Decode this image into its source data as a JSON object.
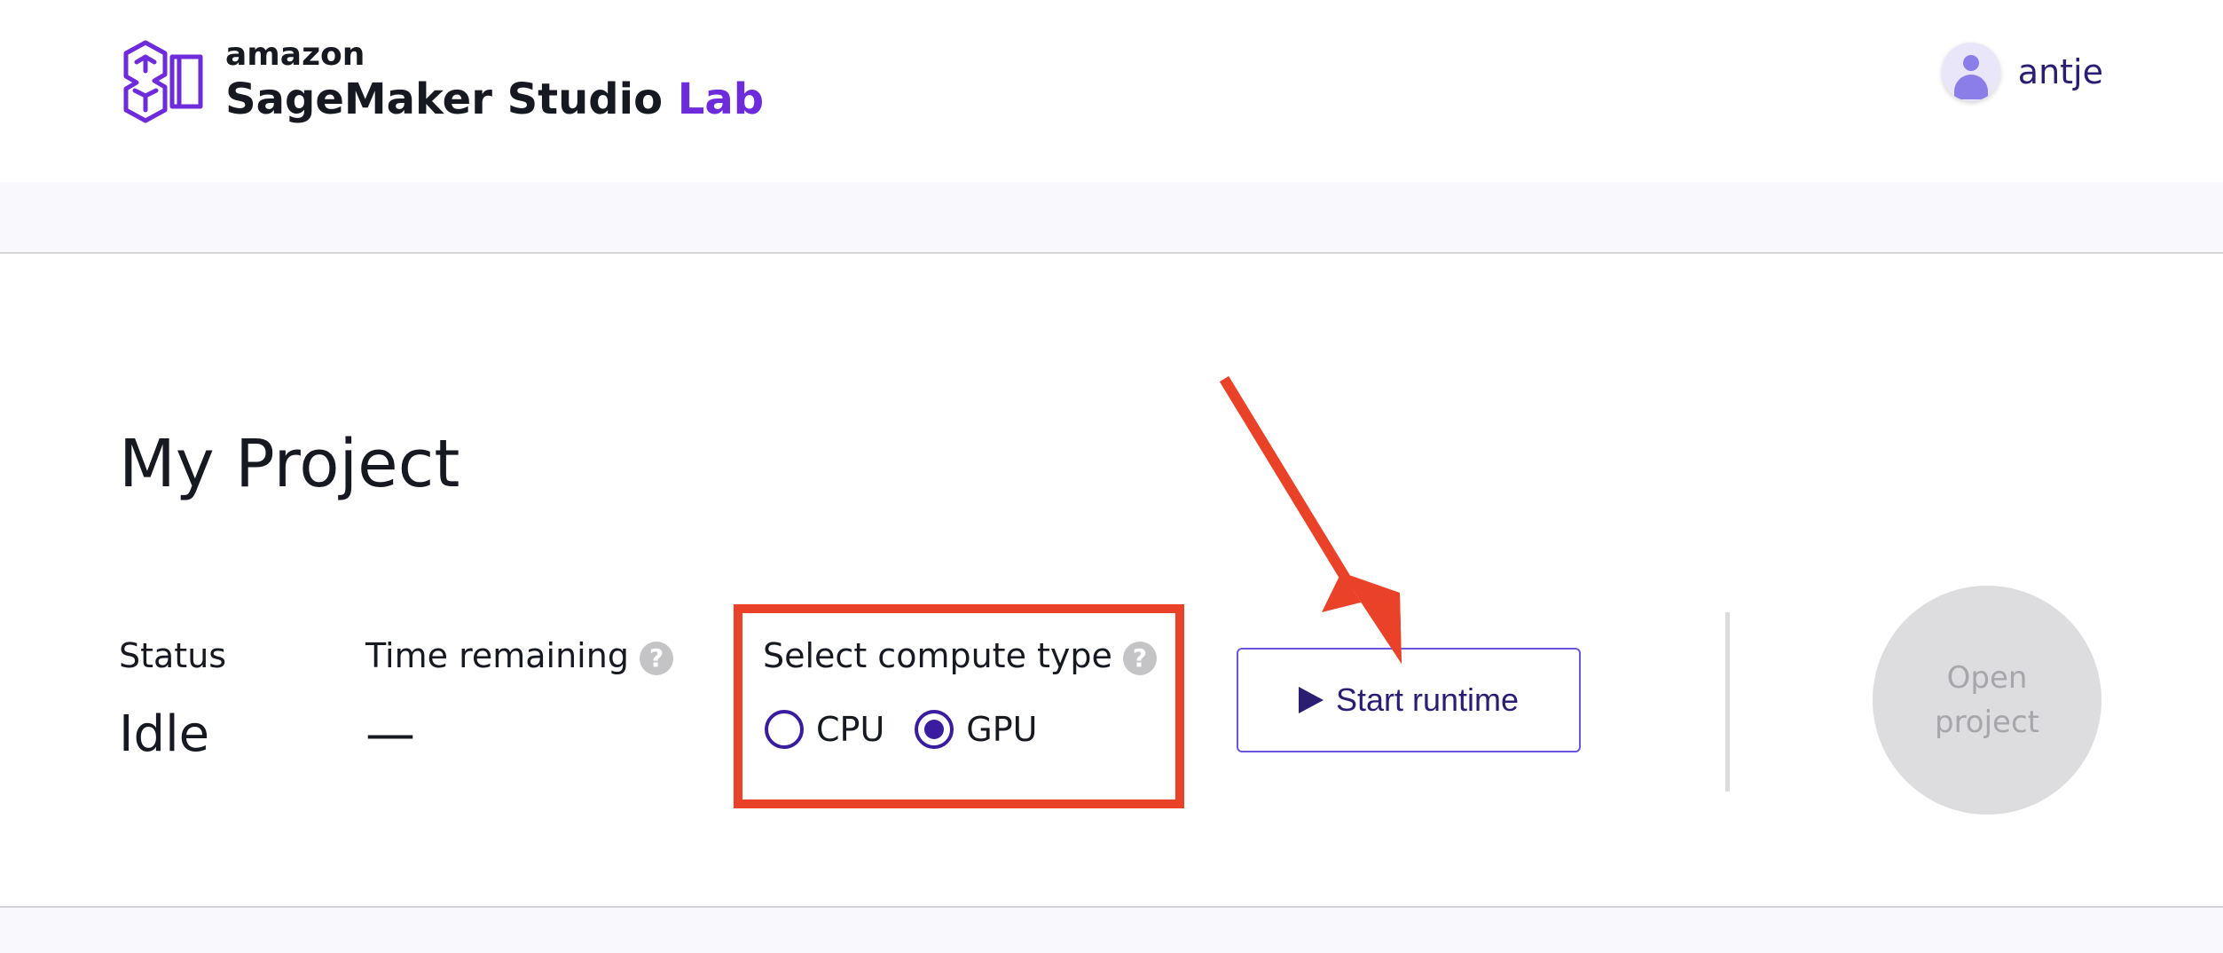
{
  "brand": {
    "company": "amazon",
    "product": "SageMaker Studio",
    "product_suffix": "Lab",
    "logo_icon": "sagemaker-studio-lab-logo-icon",
    "accent_color": "#6e2bdb"
  },
  "user": {
    "name": "antje",
    "avatar_icon": "user-avatar-icon"
  },
  "project": {
    "title": "My Project",
    "status_label": "Status",
    "status_value": "Idle",
    "time_label": "Time remaining",
    "time_value": "—",
    "compute_label": "Select compute type",
    "help_glyph": "?",
    "compute_options": [
      {
        "label": "CPU",
        "checked": false
      },
      {
        "label": "GPU",
        "checked": true
      }
    ],
    "start_button": "Start runtime",
    "open_button_line1": "Open",
    "open_button_line2": "project"
  },
  "annotations": {
    "highlight_color": "#ea4129",
    "arrow_color": "#ea4129"
  }
}
